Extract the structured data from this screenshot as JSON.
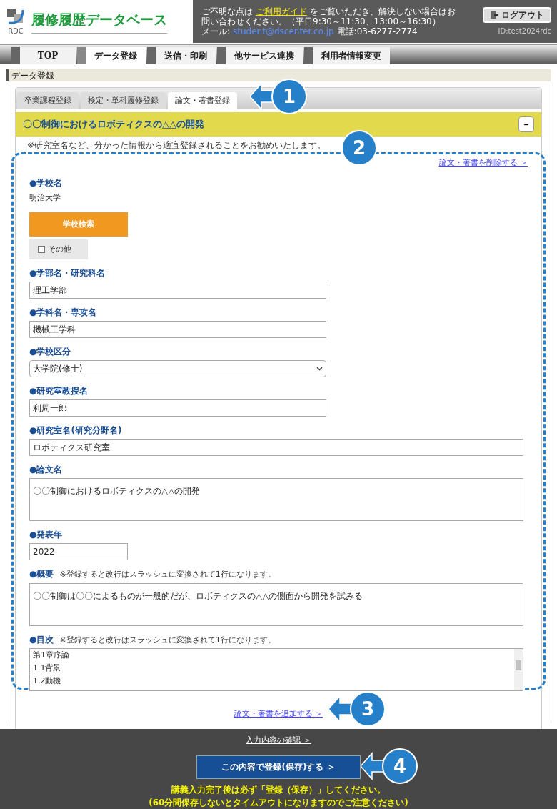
{
  "header": {
    "logo_title": "履修履歴データベース",
    "logo_sub": "RDC",
    "notice_before": "ご不明な点は",
    "guide_link": "ご利用ガイド",
    "notice_after": "をご覧いただき、解決しない場合はお問い合わせください。（平日9:30～11:30、13:00～16:30）",
    "mail_label": "メール:",
    "mail": "student@dscenter.co.jp",
    "phone": "電話:03-6277-2774",
    "user_id": "ID:test2024rdc",
    "logout": "ログアウト"
  },
  "nav": [
    {
      "label": "TOP",
      "selected": false
    },
    {
      "label": "データ登録",
      "selected": true
    },
    {
      "label": "送信・印刷",
      "selected": false
    },
    {
      "label": "他サービス連携",
      "selected": false
    },
    {
      "label": "利用者情報変更",
      "selected": false
    }
  ],
  "section_title": "データ登録",
  "tabs": [
    {
      "label": "卒業課程登録",
      "selected": false
    },
    {
      "label": "検定・単科履修登録",
      "selected": false
    },
    {
      "label": "論文・著書登録",
      "selected": true
    }
  ],
  "record": {
    "title": "〇〇制御におけるロボティクスの△△の開発",
    "expanded": true,
    "collapse_button": "－",
    "note": "※研究室名など、分かった情報から適宜登録されることをお勧めいたします。",
    "delete_link": "論文・著書を削除する ＞"
  },
  "school": {
    "label": "●学校名",
    "value": "明治大学",
    "search_button": "学校検索",
    "other": {
      "label": "その他",
      "checked": false
    }
  },
  "fields": [
    {
      "kind": "text",
      "label": "●学部名・研究科名",
      "value": "理工学部"
    },
    {
      "kind": "text",
      "label": "●学科名・専攻名",
      "value": "機械工学科"
    },
    {
      "kind": "select",
      "label": "●学校区分",
      "value": "大学院(修士)"
    },
    {
      "kind": "text",
      "label": "●研究室教授名",
      "value": "利周一郎"
    },
    {
      "kind": "text_wide",
      "label": "●研究室名(研究分野名)",
      "value": "ロボティクス研究室"
    },
    {
      "kind": "textarea",
      "label": "●論文名",
      "value": "〇〇制御におけるロボティクスの△△の開発"
    },
    {
      "kind": "text_short",
      "label": "●発表年",
      "value": "2022"
    },
    {
      "kind": "textarea",
      "label": "●概要",
      "note": "※登録すると改行はスラッシュに変換されて1行になります。",
      "value": "〇〇制御は〇〇によるものが一般的だが、ロボティクスの△△の側面から開発を試みる"
    },
    {
      "kind": "list_textarea",
      "label": "●目次",
      "note": "※登録すると改行はスラッシュに変換されて1行になります。",
      "lines": [
        "第1章序論",
        "1.1背景",
        "1.2動機"
      ]
    }
  ],
  "add_link": "論文・著書を追加する ＞",
  "footer": {
    "confirm_link": "入力内容の確認 ＞",
    "save_button": "この内容で登録(保存)する ＞",
    "warning": "講義入力完了後は必ず「登録（保存）」してください。",
    "timeout_note": "(60分間保存しないとタイムアウトになりますのでご注意ください)"
  },
  "callouts": [
    "1",
    "2",
    "3",
    "4"
  ]
}
